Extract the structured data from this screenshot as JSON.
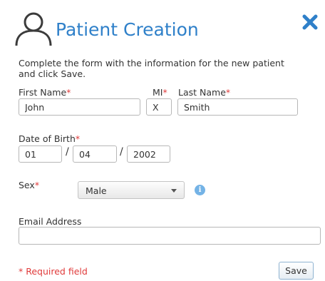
{
  "header": {
    "title": "Patient Creation",
    "icon": "person-icon",
    "close_icon": "close-icon",
    "accent_color": "#2f80c9"
  },
  "instructions": "Complete the form with the information for the new patient and click Save.",
  "fields": {
    "first_name": {
      "label": "First Name",
      "required_mark": "*",
      "value": "John"
    },
    "middle_initial": {
      "label": "MI",
      "required_mark": "*",
      "value": "X"
    },
    "last_name": {
      "label": "Last Name",
      "required_mark": "*",
      "value": "Smith"
    },
    "date_of_birth": {
      "label": "Date of Birth",
      "required_mark": "*",
      "separator": "/",
      "month": "01",
      "day": "04",
      "year": "2002"
    },
    "sex": {
      "label": "Sex",
      "required_mark": "*",
      "value": "Male",
      "info_glyph": "i"
    },
    "email": {
      "label": "Email Address",
      "value": ""
    }
  },
  "footer": {
    "required_note": "* Required field",
    "save_label": "Save"
  }
}
